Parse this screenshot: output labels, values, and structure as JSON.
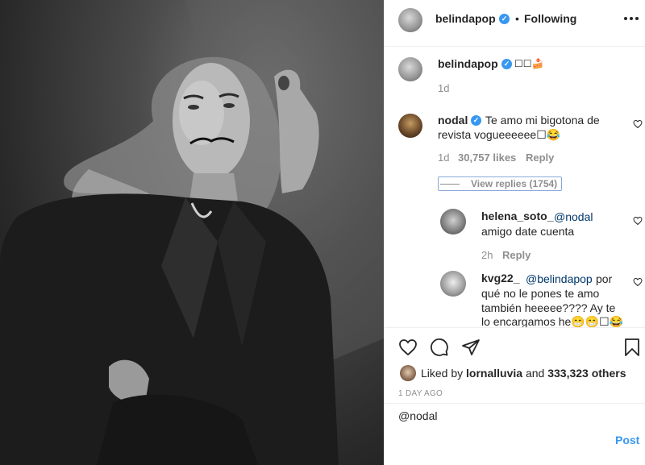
{
  "post": {
    "author": "belindapop",
    "follow_sep": "•",
    "follow_label": "Following",
    "more_icon": "more-horizontal-icon"
  },
  "caption": {
    "author": "belindapop",
    "text": "☐☐🍰",
    "time": "1d"
  },
  "comments": [
    {
      "author": "nodal",
      "text": "Te amo mi bigotona de revista vogueeeeee☐😂",
      "time": "1d",
      "likes": "30,757 likes",
      "reply_label": "Reply",
      "view_replies": "View replies (1754)"
    }
  ],
  "replies": [
    {
      "author": "helena_soto_",
      "mention": "@nodal",
      "text": "amigo date cuenta",
      "time": "2h",
      "reply_label": "Reply"
    },
    {
      "author": "kvg22_",
      "mention": "@belindapop",
      "text_line1": "por",
      "text_line2": "qué no le pones te amo",
      "text_line3": "también heeeee???? Ay te",
      "text_line4": "lo encargamos he😁😁☐😂"
    }
  ],
  "likes": {
    "prefix": "Liked by",
    "user": "lornalluvia",
    "and": "and",
    "count": "333,323 others"
  },
  "timestamp": "1 DAY AGO",
  "comment_input": {
    "value": "@nodal",
    "post_label": "Post"
  },
  "colors": {
    "link": "#3897f0",
    "verified": "#3897f0",
    "muted": "#8e8e8e"
  }
}
